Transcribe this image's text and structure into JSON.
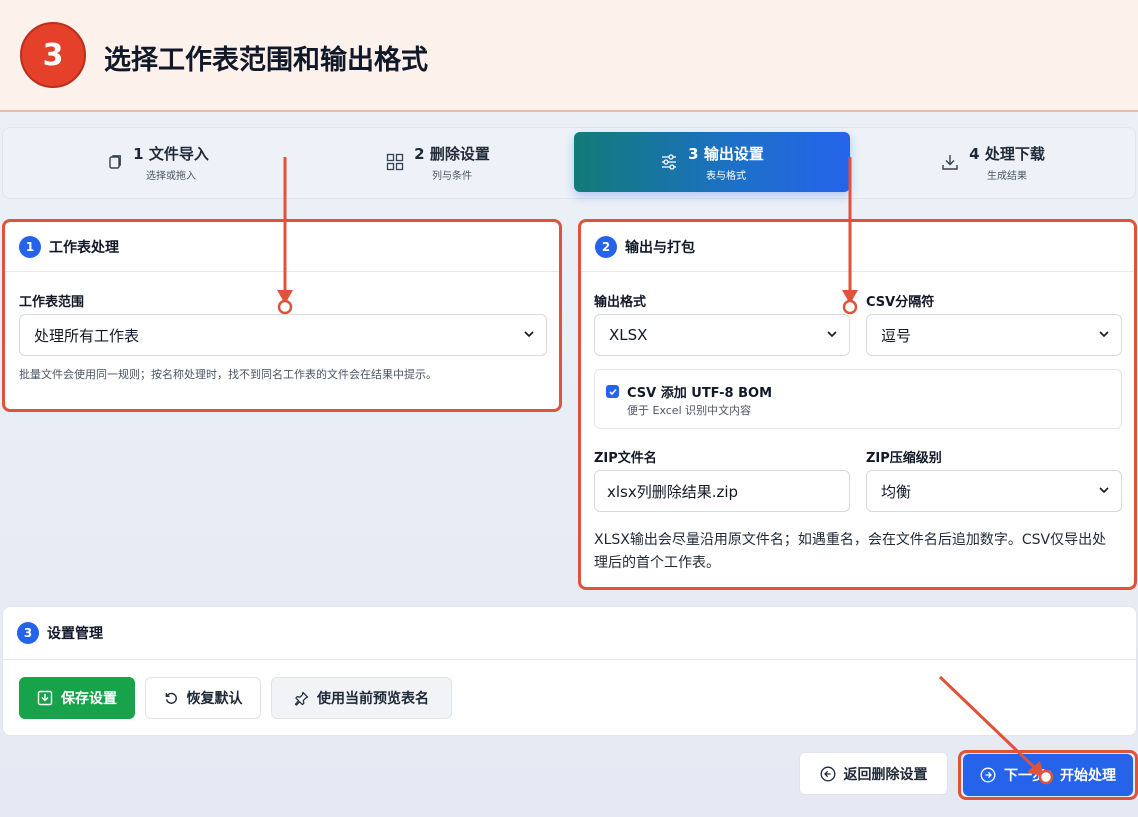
{
  "banner": {
    "step_number": "3",
    "title": "选择工作表范围和输出格式"
  },
  "tabs": [
    {
      "label": "1 文件导入",
      "sub": "选择或拖入",
      "icon": "file-icon"
    },
    {
      "label": "2 删除设置",
      "sub": "列与条件",
      "icon": "grid-icon"
    },
    {
      "label": "3 输出设置",
      "sub": "表与格式",
      "icon": "sliders-icon"
    },
    {
      "label": "4 处理下载",
      "sub": "生成结果",
      "icon": "download-icon"
    }
  ],
  "sheet_card": {
    "number": "1",
    "title": "工作表处理",
    "range_label": "工作表范围",
    "range_value": "处理所有工作表",
    "hint": "批量文件会使用同一规则；按名称处理时，找不到同名工作表的文件会在结果中提示。"
  },
  "output_card": {
    "number": "2",
    "title": "输出与打包",
    "format_label": "输出格式",
    "format_value": "XLSX",
    "csv_sep_label": "CSV分隔符",
    "csv_sep_value": "逗号",
    "bom_label": "CSV 添加 UTF-8 BOM",
    "bom_hint": "便于 Excel 识别中文内容",
    "zip_name_label": "ZIP文件名",
    "zip_name_value": "xlsx列删除结果.zip",
    "zip_level_label": "ZIP压缩级别",
    "zip_level_value": "均衡",
    "note": "XLSX输出会尽量沿用原文件名；如遇重名，会在文件名后追加数字。CSV仅导出处理后的首个工作表。"
  },
  "settings_card": {
    "number": "3",
    "title": "设置管理",
    "save_label": "保存设置",
    "reset_label": "恢复默认",
    "use_preview_label": "使用当前预览表名"
  },
  "footer": {
    "back_label": "返回删除设置",
    "next_label": "下一步：开始处理"
  },
  "colors": {
    "accent": "#2563eb",
    "annotation": "#e0533b",
    "save": "#16a34a",
    "step": "#e5402a"
  }
}
